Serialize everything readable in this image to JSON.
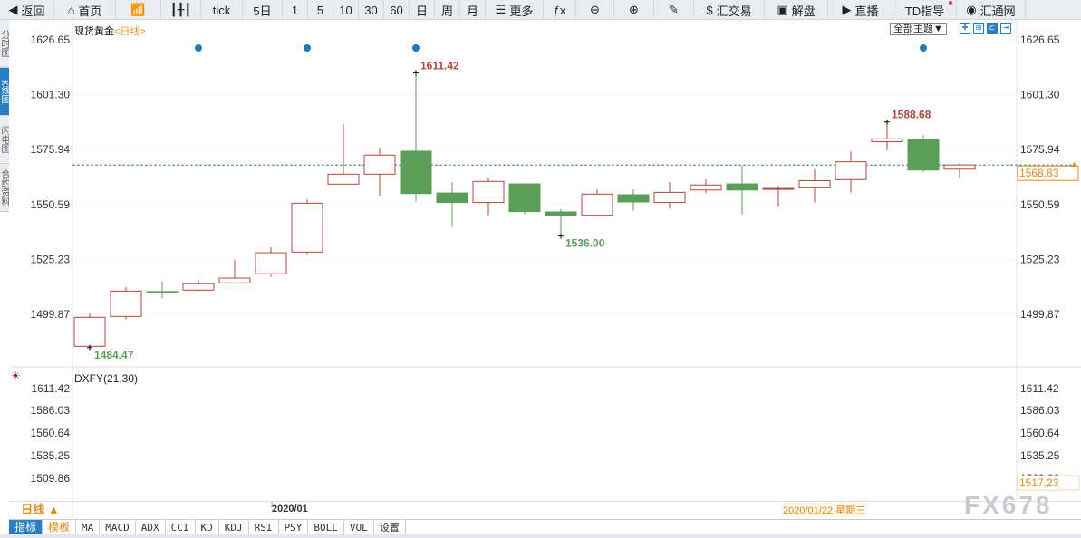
{
  "toolbar": {
    "items": [
      {
        "icon": "back-arrow-icon",
        "glyph": "◀",
        "label": "返回",
        "w": 60
      },
      {
        "icon": "home-icon",
        "glyph": "⌂",
        "label": "首页",
        "w": 68
      },
      {
        "icon": "bar-chart-icon",
        "glyph": "📶",
        "label": "",
        "w": 50
      },
      {
        "icon": "candlestick-icon",
        "glyph": "┃╂┃",
        "label": "",
        "w": 44
      },
      {
        "icon": "",
        "glyph": "",
        "label": "tick",
        "w": 46
      },
      {
        "icon": "",
        "glyph": "",
        "label": "5日",
        "w": 44
      },
      {
        "icon": "",
        "glyph": "",
        "label": "1",
        "w": 28
      },
      {
        "icon": "",
        "glyph": "",
        "label": "5",
        "w": 28
      },
      {
        "icon": "",
        "glyph": "",
        "label": "10",
        "w": 28
      },
      {
        "icon": "",
        "glyph": "",
        "label": "30",
        "w": 28
      },
      {
        "icon": "",
        "glyph": "",
        "label": "60",
        "w": 28
      },
      {
        "icon": "",
        "glyph": "",
        "label": "日",
        "w": 28
      },
      {
        "icon": "",
        "glyph": "",
        "label": "周",
        "w": 28
      },
      {
        "icon": "",
        "glyph": "",
        "label": "月",
        "w": 28
      },
      {
        "icon": "list-icon",
        "glyph": "☰",
        "label": "更多",
        "w": 64
      },
      {
        "icon": "fx-icon",
        "glyph": "ƒx",
        "label": "",
        "w": 36
      },
      {
        "icon": "zoom-out-icon",
        "glyph": "⊖",
        "label": "",
        "w": 42
      },
      {
        "icon": "zoom-in-icon",
        "glyph": "⊕",
        "label": "",
        "w": 44
      },
      {
        "icon": "pen-icon",
        "glyph": "✎",
        "label": "",
        "w": 44
      },
      {
        "icon": "dollar-icon",
        "glyph": "$",
        "label": "汇交易",
        "w": 78
      },
      {
        "icon": "chat-icon",
        "glyph": "▣",
        "label": "解盘",
        "w": 70
      },
      {
        "icon": "video-icon",
        "glyph": "▶",
        "label": "直播",
        "w": 72
      },
      {
        "icon": "",
        "glyph": "",
        "label": "TD指导",
        "w": 70
      },
      {
        "icon": "logo-icon",
        "glyph": "◉",
        "label": "汇通网",
        "w": 76
      }
    ]
  },
  "side_tabs": [
    {
      "label": "分时图",
      "active": false
    },
    {
      "label": "K线图",
      "active": true
    },
    {
      "label": "闪电图",
      "active": false
    },
    {
      "label": "合约资料",
      "active": false
    }
  ],
  "main": {
    "symbol": "现货黄金",
    "period_tag": "<日线>",
    "theme_select": "全部主题▼",
    "current_price": "1568.83"
  },
  "lower": {
    "indicator": "DXFY(21,30)",
    "ticks": [
      "1611.42",
      "1586.03",
      "1560.64",
      "1535.25",
      "1509.86"
    ],
    "current": "1517.23"
  },
  "datebar": {
    "period": "日线 ▲",
    "month": "2020/01",
    "cursor_date": "2020/01/22 星期三"
  },
  "watermark": "FX678",
  "bottom_tabs": [
    "指标",
    "模板",
    "MA",
    "MACD",
    "ADX",
    "CCI",
    "KD",
    "KDJ",
    "RSI",
    "PSY",
    "BOLL",
    "VOL",
    "设置"
  ],
  "colors": {
    "up": "#b0463c",
    "down": "#5a9e57",
    "accent": "#2a7ec3",
    "highlight": "#e08a1a",
    "marker": "#1f7ab8"
  },
  "chart_data": {
    "type": "candlestick",
    "yticks": [
      "1626.65",
      "1601.30",
      "1575.94",
      "1550.59",
      "1525.23",
      "1499.87"
    ],
    "ylim": [
      1484.47,
      1626.65
    ],
    "annotations": [
      {
        "label": "1484.47",
        "type": "low"
      },
      {
        "label": "1611.42",
        "type": "high"
      },
      {
        "label": "1536.00",
        "type": "low"
      },
      {
        "label": "1588.68",
        "type": "high"
      }
    ],
    "event_markers": [
      4,
      7,
      10,
      24
    ],
    "ohlc": [
      [
        1485.1,
        1500.3,
        1484.47,
        1498.5
      ],
      [
        1498.9,
        1512.4,
        1497.5,
        1510.6
      ],
      [
        1510.4,
        1515.1,
        1507.3,
        1510.2
      ],
      [
        1511.05,
        1515.8,
        1510.5,
        1514.0
      ],
      [
        1514.4,
        1525.1,
        1514.4,
        1516.6
      ],
      [
        1518.6,
        1530.8,
        1517.2,
        1528.3
      ],
      [
        1528.6,
        1552.9,
        1527.6,
        1551.2
      ],
      [
        1560.0,
        1587.7,
        1560.0,
        1564.6
      ],
      [
        1564.6,
        1576.9,
        1554.8,
        1573.4
      ],
      [
        1575.2,
        1611.42,
        1552.0,
        1555.65
      ],
      [
        1555.9,
        1560.9,
        1540.2,
        1551.5
      ],
      [
        1551.5,
        1562.8,
        1545.6,
        1561.25
      ],
      [
        1560.1,
        1560.5,
        1546.0,
        1547.3
      ],
      [
        1547.15,
        1548.4,
        1536.0,
        1545.6
      ],
      [
        1545.6,
        1557.6,
        1545.5,
        1555.4
      ],
      [
        1555.1,
        1557.6,
        1547.6,
        1551.75
      ],
      [
        1551.5,
        1560.9,
        1548.7,
        1556.2
      ],
      [
        1557.3,
        1562.2,
        1555.9,
        1559.6
      ],
      [
        1560.1,
        1568.5,
        1546.0,
        1557.3
      ],
      [
        1557.7,
        1559.0,
        1549.8,
        1558.0
      ],
      [
        1558.3,
        1566.9,
        1551.6,
        1561.6
      ],
      [
        1562.1,
        1575.1,
        1556.1,
        1570.3
      ],
      [
        1579.6,
        1588.68,
        1575.6,
        1580.9
      ],
      [
        1580.6,
        1582.6,
        1565.6,
        1566.5
      ],
      [
        1566.9,
        1569.6,
        1563.2,
        1568.83
      ]
    ]
  }
}
